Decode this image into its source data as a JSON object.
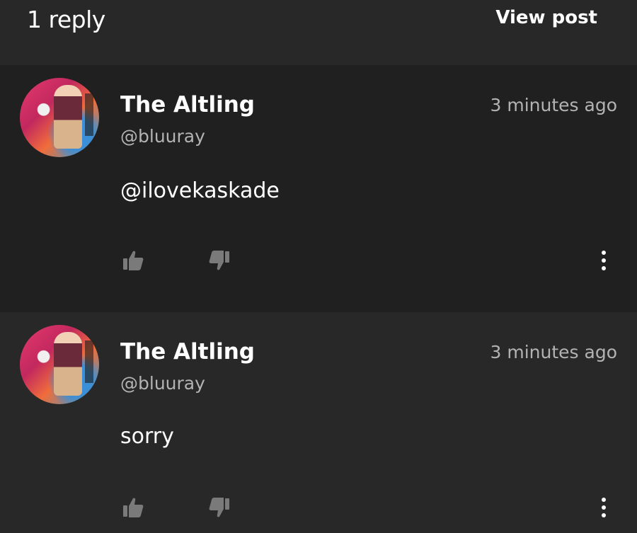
{
  "header": {
    "reply_count": "1 reply",
    "view_post": "View post"
  },
  "comments": [
    {
      "name": "The Altling",
      "handle": "@bluuray",
      "time": "3 minutes ago",
      "text": "@ilovekaskade"
    },
    {
      "name": "The Altling",
      "handle": "@bluuray",
      "time": "3 minutes ago",
      "text": "sorry"
    }
  ],
  "icons": {
    "like": "thumbs-up-icon",
    "dislike": "thumbs-down-icon",
    "more": "more-vertical-icon"
  },
  "colors": {
    "background": "#262626",
    "header_bg": "#282828",
    "comment1_bg": "#202020",
    "comment2_bg": "#282828",
    "secondary_text": "#b3b3b3",
    "icon_gray": "#7a7a7a"
  }
}
